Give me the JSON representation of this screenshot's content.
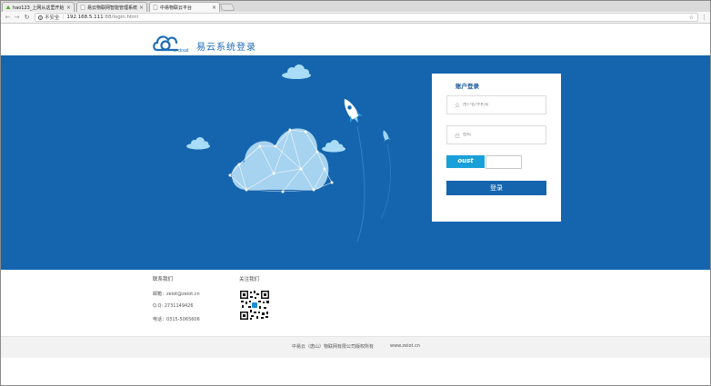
{
  "browser": {
    "tabs": [
      {
        "title": "hao123_上网从这里开始",
        "active": false
      },
      {
        "title": "易云物联网智能管理系统",
        "active": false
      },
      {
        "title": "中易物联云平台",
        "active": true
      }
    ],
    "close_glyph": "×",
    "security_label": "不安全",
    "url_host": "192.168.5.111",
    "url_path": ":88/login.html"
  },
  "header": {
    "logo_text": "e-cloud",
    "title": "易云系统登录"
  },
  "login": {
    "title": "账户登录",
    "username_placeholder": "用户名/手机号",
    "password_placeholder": "密码",
    "captcha_text": "oust",
    "submit_label": "登录"
  },
  "contact": {
    "heading": "联系我们",
    "email": "邮箱：zeiot@zeiot.cn",
    "qq": "Q.Q: 2731149426",
    "phone": "电话：0315-5065606"
  },
  "follow": {
    "heading": "关注我们"
  },
  "footer": {
    "copyright": "中易云（唐山）物联网有限公司版权所有",
    "website": "www.zeiot.cn"
  },
  "colors": {
    "brand_blue": "#1565ae",
    "captcha_bg": "#1aa0d8"
  }
}
